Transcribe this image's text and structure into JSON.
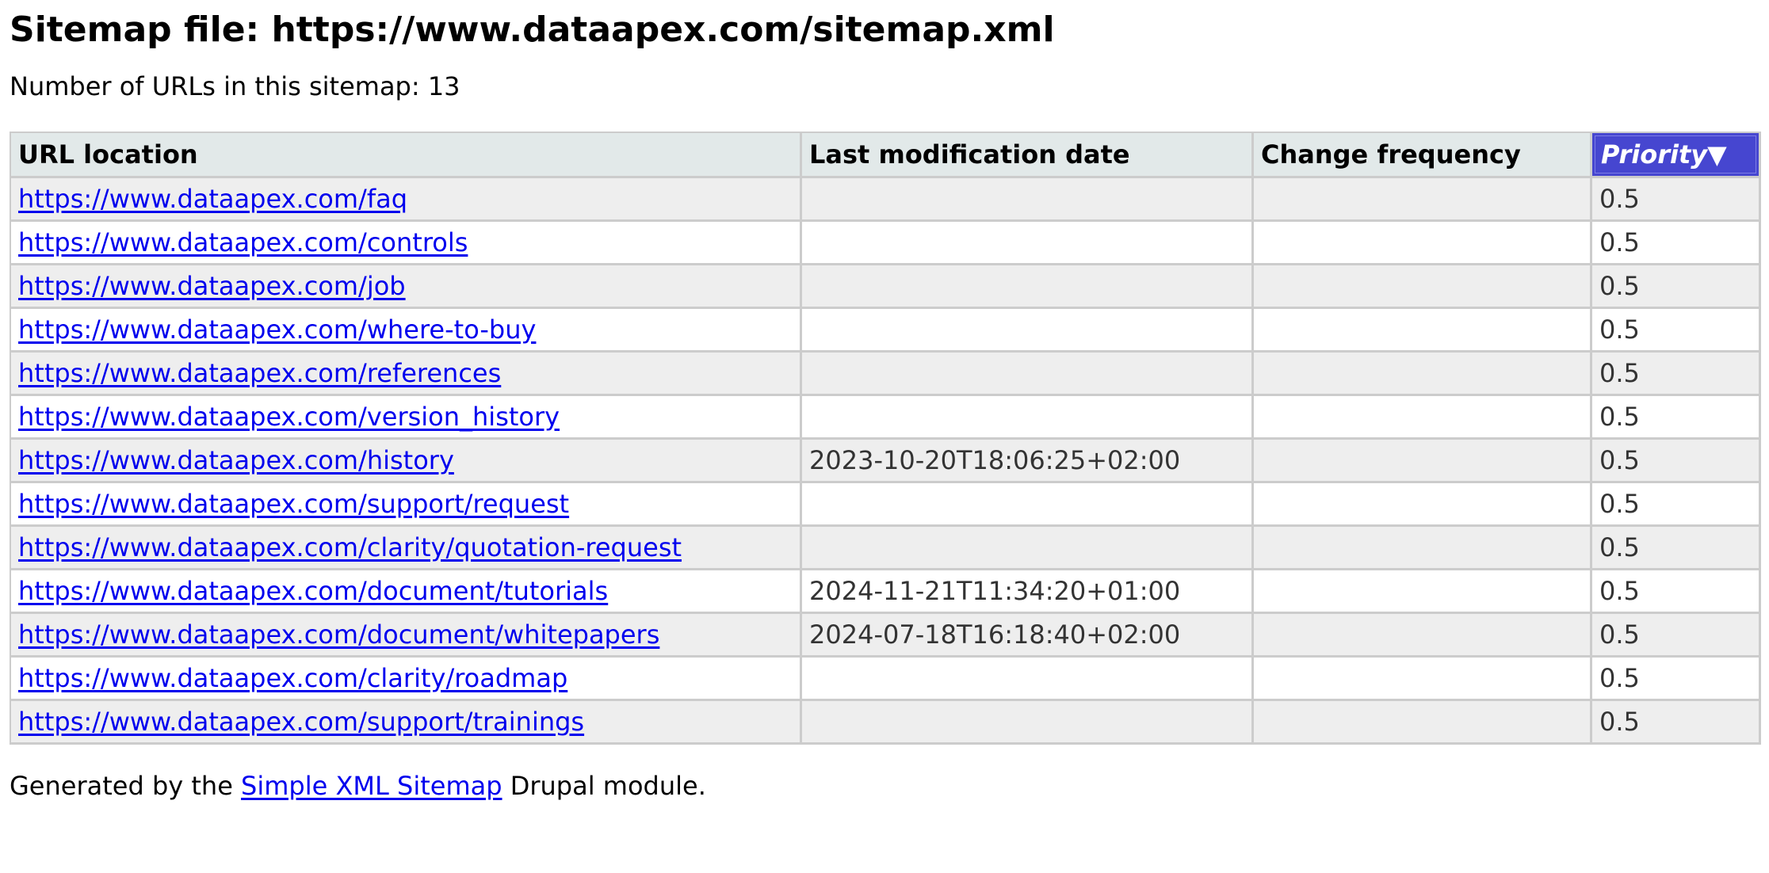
{
  "heading": "Sitemap file: https://www.dataapex.com/sitemap.xml",
  "url_count_text": "Number of URLs in this sitemap: 13",
  "table": {
    "columns": [
      "URL location",
      "Last modification date",
      "Change frequency",
      "Priority▼"
    ],
    "sorted_column_color": "#4646d0",
    "rows": [
      {
        "loc": "https://www.dataapex.com/faq",
        "lastmod": "",
        "changefreq": "",
        "priority": "0.5"
      },
      {
        "loc": "https://www.dataapex.com/controls",
        "lastmod": "",
        "changefreq": "",
        "priority": "0.5"
      },
      {
        "loc": "https://www.dataapex.com/job",
        "lastmod": "",
        "changefreq": "",
        "priority": "0.5"
      },
      {
        "loc": "https://www.dataapex.com/where-to-buy",
        "lastmod": "",
        "changefreq": "",
        "priority": "0.5"
      },
      {
        "loc": "https://www.dataapex.com/references",
        "lastmod": "",
        "changefreq": "",
        "priority": "0.5"
      },
      {
        "loc": "https://www.dataapex.com/version_history",
        "lastmod": "",
        "changefreq": "",
        "priority": "0.5"
      },
      {
        "loc": "https://www.dataapex.com/history",
        "lastmod": "2023-10-20T18:06:25+02:00",
        "changefreq": "",
        "priority": "0.5"
      },
      {
        "loc": "https://www.dataapex.com/support/request",
        "lastmod": "",
        "changefreq": "",
        "priority": "0.5"
      },
      {
        "loc": "https://www.dataapex.com/clarity/quotation-request",
        "lastmod": "",
        "changefreq": "",
        "priority": "0.5"
      },
      {
        "loc": "https://www.dataapex.com/document/tutorials",
        "lastmod": "2024-11-21T11:34:20+01:00",
        "changefreq": "",
        "priority": "0.5"
      },
      {
        "loc": "https://www.dataapex.com/document/whitepapers",
        "lastmod": "2024-07-18T16:18:40+02:00",
        "changefreq": "",
        "priority": "0.5"
      },
      {
        "loc": "https://www.dataapex.com/clarity/roadmap",
        "lastmod": "",
        "changefreq": "",
        "priority": "0.5"
      },
      {
        "loc": "https://www.dataapex.com/support/trainings",
        "lastmod": "",
        "changefreq": "",
        "priority": "0.5"
      }
    ]
  },
  "footer": {
    "prefix": "Generated by the ",
    "link_text": "Simple XML Sitemap",
    "suffix": " Drupal module."
  }
}
